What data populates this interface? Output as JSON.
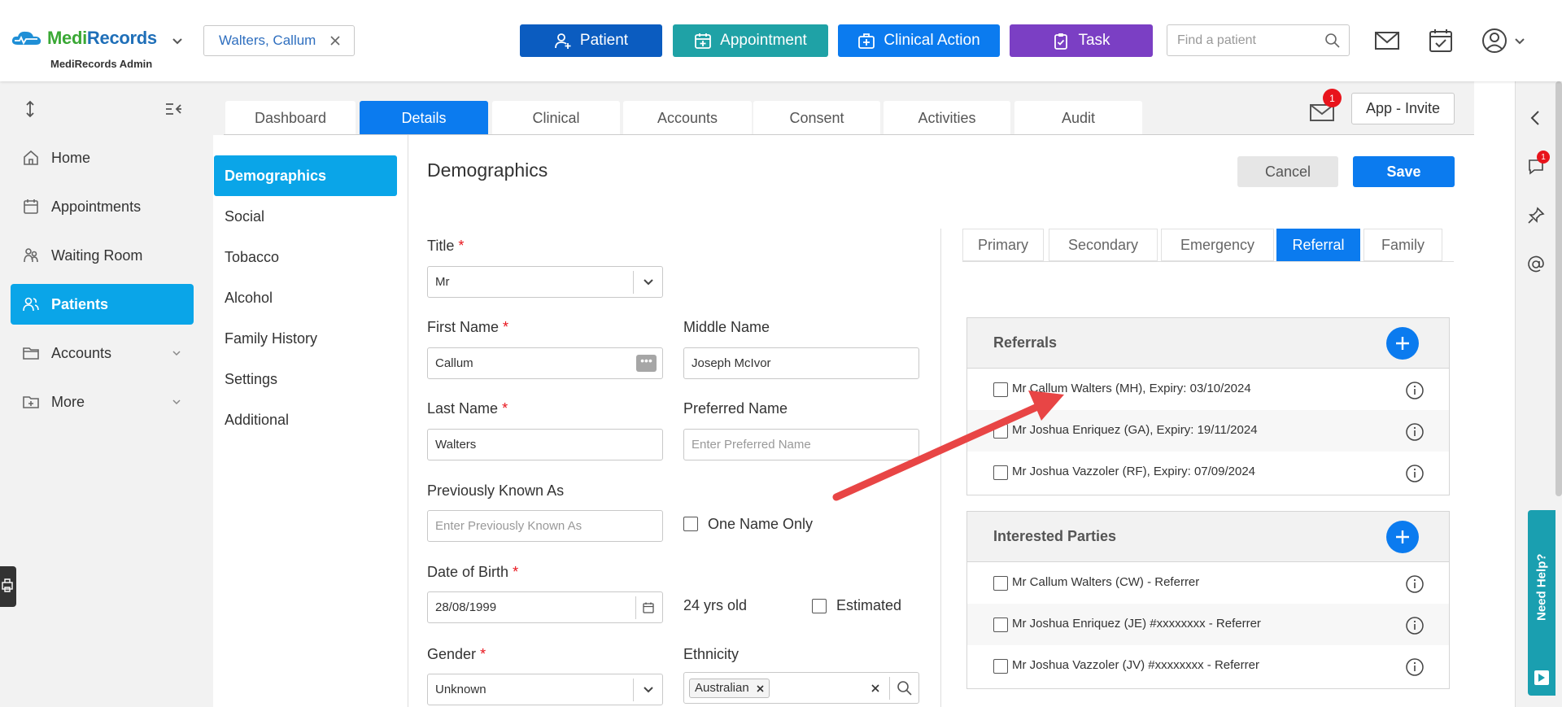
{
  "brand": {
    "name_part1": "Medi",
    "name_part2": "Records",
    "subtitle": "MediRecords Admin",
    "green": "#3aa835",
    "blue": "#1f6fb8"
  },
  "header": {
    "patient_chip": "Walters, Callum",
    "actions": {
      "patient": "Patient",
      "appointment": "Appointment",
      "clinical_action": "Clinical Action",
      "task": "Task"
    },
    "search_placeholder": "Find a patient",
    "icons": [
      "mail-icon",
      "calendar-check-icon",
      "user-circle-icon",
      "chevron-down-icon"
    ]
  },
  "sidebar": {
    "items": [
      {
        "label": "Home",
        "icon": "home-icon"
      },
      {
        "label": "Appointments",
        "icon": "calendar-icon"
      },
      {
        "label": "Waiting Room",
        "icon": "waiting-room-icon"
      },
      {
        "label": "Patients",
        "icon": "patients-icon"
      },
      {
        "label": "Accounts",
        "icon": "folder-icon"
      },
      {
        "label": "More",
        "icon": "folder-plus-icon"
      }
    ]
  },
  "tabs": [
    "Dashboard",
    "Details",
    "Clinical",
    "Accounts",
    "Consent",
    "Activities",
    "Audit"
  ],
  "active_tab": "Details",
  "mail_badge_count": "1",
  "app_invite_label": "App - Invite",
  "sub_nav": [
    "Demographics",
    "Social",
    "Tobacco",
    "Alcohol",
    "Family History",
    "Settings",
    "Additional"
  ],
  "section": {
    "title": "Demographics",
    "cancel_label": "Cancel",
    "save_label": "Save"
  },
  "form": {
    "title_label": "Title",
    "title_value": "Mr",
    "first_name_label": "First Name",
    "first_name_value": "Callum",
    "middle_name_label": "Middle Name",
    "middle_name_value": "Joseph McIvor",
    "last_name_label": "Last Name",
    "last_name_value": "Walters",
    "preferred_name_label": "Preferred Name",
    "preferred_name_placeholder": "Enter Preferred Name",
    "prev_known_label": "Previously Known As",
    "prev_known_placeholder": "Enter Previously Known As",
    "one_name_only_label": "One Name Only",
    "dob_label": "Date of Birth",
    "dob_value": "28/08/1999",
    "age_text": "24 yrs old",
    "estimated_label": "Estimated",
    "gender_label": "Gender",
    "gender_value": "Unknown",
    "ethnicity_label": "Ethnicity",
    "ethnicity_value": "Australian",
    "required_mark": "*"
  },
  "right_tabs": [
    "Primary",
    "Secondary",
    "Emergency",
    "Referral",
    "Family"
  ],
  "right_active_tab": "Referral",
  "referrals": {
    "title": "Referrals",
    "rows": [
      "Mr Callum Walters (MH), Expiry: 03/10/2024",
      "Mr Joshua Enriquez (GA), Expiry: 19/11/2024",
      "Mr Joshua Vazzoler (RF), Expiry: 07/09/2024"
    ]
  },
  "interested_parties": {
    "title": "Interested Parties",
    "rows": [
      "Mr Callum Walters (CW) - Referrer",
      "Mr Joshua Enriquez (JE) #xxxxxxxx - Referrer",
      "Mr Joshua Vazzoler (JV) #xxxxxxxx - Referrer"
    ]
  },
  "right_rail": {
    "chat_badge": "1",
    "help_label": "Need Help?"
  },
  "colors": {
    "primary": "#0b7bef",
    "nav_active": "#0aa5e8",
    "appointment": "#1fa2a6",
    "task": "#7b3fc4",
    "arrow": "#e84545"
  }
}
